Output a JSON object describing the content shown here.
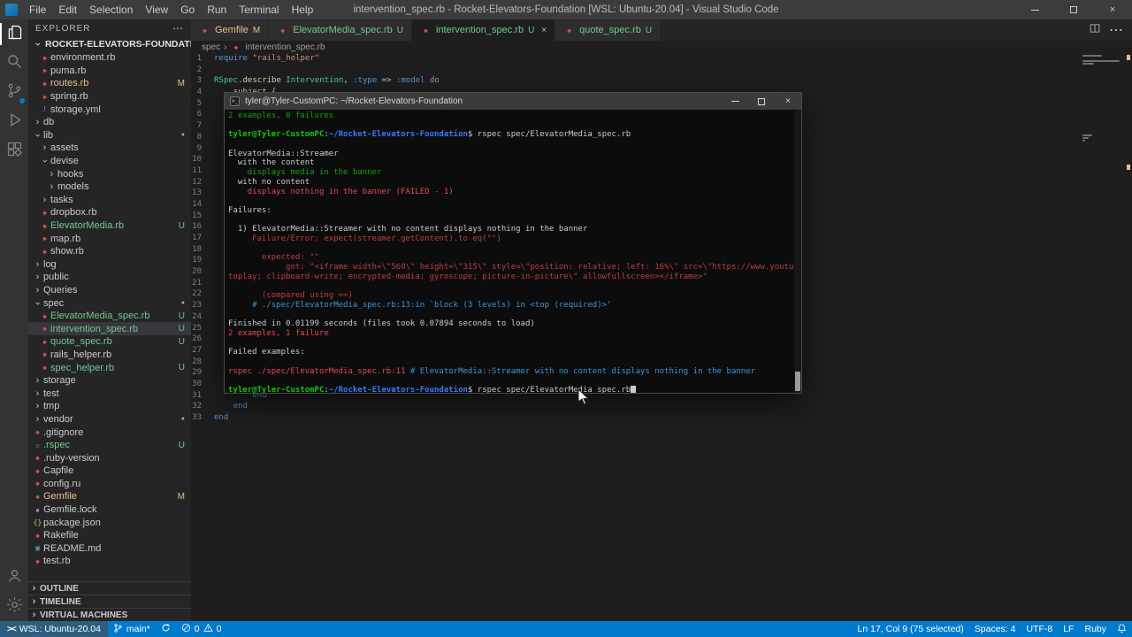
{
  "icons": {
    "chevron": "›",
    "more": "⋯",
    "close": "×",
    "remote": "><",
    "ruby_file": "◆",
    "breadcrumb_sep": "›"
  },
  "title_bar": {
    "menus": [
      "File",
      "Edit",
      "Selection",
      "View",
      "Go",
      "Run",
      "Terminal",
      "Help"
    ],
    "title": "intervention_spec.rb - Rocket-Elevators-Foundation [WSL: Ubuntu-20.04] - Visual Studio Code"
  },
  "activity_bar": {
    "top": [
      {
        "name": "explorer",
        "active": true
      },
      {
        "name": "search",
        "active": false
      },
      {
        "name": "source-control",
        "active": false,
        "badge": true
      },
      {
        "name": "run-debug",
        "active": false
      },
      {
        "name": "extensions",
        "active": false
      }
    ],
    "bottom": [
      {
        "name": "account",
        "active": false
      },
      {
        "name": "settings",
        "active": false
      }
    ]
  },
  "explorer": {
    "title": "EXPLORER",
    "workspace": "ROCKET-ELEVATORS-FOUNDATION [WSL: UBU...",
    "items": [
      {
        "label": "environment.rb",
        "kind": "file",
        "indent": 1,
        "icon": "ruby"
      },
      {
        "label": "puma.rb",
        "kind": "file",
        "indent": 1,
        "icon": "ruby"
      },
      {
        "label": "routes.rb",
        "kind": "file",
        "indent": 1,
        "icon": "ruby",
        "badge": "M",
        "git": "modified"
      },
      {
        "label": "spring.rb",
        "kind": "file",
        "indent": 1,
        "icon": "ruby"
      },
      {
        "label": "storage.yml",
        "kind": "file",
        "indent": 1,
        "icon": "yaml"
      },
      {
        "label": "db",
        "kind": "folder",
        "indent": 0,
        "chevron": "collapsed"
      },
      {
        "label": "lib",
        "kind": "folder",
        "indent": 0,
        "chevron": "expanded",
        "badge": "dot"
      },
      {
        "label": "assets",
        "kind": "folder",
        "indent": 1,
        "chevron": "collapsed"
      },
      {
        "label": "devise",
        "kind": "folder",
        "indent": 1,
        "chevron": "expanded"
      },
      {
        "label": "hooks",
        "kind": "folder",
        "indent": 2,
        "chevron": "collapsed"
      },
      {
        "label": "models",
        "kind": "folder",
        "indent": 2,
        "chevron": "collapsed"
      },
      {
        "label": "tasks",
        "kind": "folder",
        "indent": 1,
        "chevron": "collapsed"
      },
      {
        "label": "dropbox.rb",
        "kind": "file",
        "indent": 1,
        "icon": "ruby"
      },
      {
        "label": "ElevatorMedia.rb",
        "kind": "file",
        "indent": 1,
        "icon": "ruby",
        "badge": "U",
        "git": "untracked"
      },
      {
        "label": "map.rb",
        "kind": "file",
        "indent": 1,
        "icon": "ruby"
      },
      {
        "label": "show.rb",
        "kind": "file",
        "indent": 1,
        "icon": "ruby"
      },
      {
        "label": "log",
        "kind": "folder",
        "indent": 0,
        "chevron": "collapsed"
      },
      {
        "label": "public",
        "kind": "folder",
        "indent": 0,
        "chevron": "collapsed"
      },
      {
        "label": "Queries",
        "kind": "folder",
        "indent": 0,
        "chevron": "collapsed"
      },
      {
        "label": "spec",
        "kind": "folder",
        "indent": 0,
        "chevron": "expanded",
        "badge": "dot"
      },
      {
        "label": "ElevatorMedia_spec.rb",
        "kind": "file",
        "indent": 1,
        "icon": "ruby",
        "badge": "U",
        "git": "untracked"
      },
      {
        "label": "intervention_spec.rb",
        "kind": "file",
        "indent": 1,
        "icon": "ruby",
        "badge": "U",
        "git": "untracked",
        "selected": true
      },
      {
        "label": "quote_spec.rb",
        "kind": "file",
        "indent": 1,
        "icon": "ruby",
        "badge": "U",
        "git": "untracked"
      },
      {
        "label": "rails_helper.rb",
        "kind": "file",
        "indent": 1,
        "icon": "ruby"
      },
      {
        "label": "spec_helper.rb",
        "kind": "file",
        "indent": 1,
        "icon": "ruby",
        "badge": "U",
        "git": "untracked"
      },
      {
        "label": "storage",
        "kind": "folder",
        "indent": 0,
        "chevron": "collapsed"
      },
      {
        "label": "test",
        "kind": "folder",
        "indent": 0,
        "chevron": "collapsed"
      },
      {
        "label": "tmp",
        "kind": "folder",
        "indent": 0,
        "chevron": "collapsed"
      },
      {
        "label": "vendor",
        "kind": "folder",
        "indent": 0,
        "chevron": "collapsed",
        "badge": "dot"
      },
      {
        "label": ".gitignore",
        "kind": "file",
        "indent": 0,
        "icon": "git"
      },
      {
        "label": ".rspec",
        "kind": "file",
        "indent": 0,
        "icon": "generic",
        "badge": "U",
        "git": "untracked"
      },
      {
        "label": ".ruby-version",
        "kind": "file",
        "indent": 0,
        "icon": "ruby"
      },
      {
        "label": "Capfile",
        "kind": "file",
        "indent": 0,
        "icon": "ruby"
      },
      {
        "label": "config.ru",
        "kind": "file",
        "indent": 0,
        "icon": "ruby"
      },
      {
        "label": "Gemfile",
        "kind": "file",
        "indent": 0,
        "icon": "ruby",
        "badge": "M",
        "git": "modified"
      },
      {
        "label": "Gemfile.lock",
        "kind": "file",
        "indent": 0,
        "icon": "lock"
      },
      {
        "label": "package.json",
        "kind": "file",
        "indent": 0,
        "icon": "json"
      },
      {
        "label": "Rakefile",
        "kind": "file",
        "indent": 0,
        "icon": "ruby"
      },
      {
        "label": "README.md",
        "kind": "file",
        "indent": 0,
        "icon": "md"
      },
      {
        "label": "test.rb",
        "kind": "file",
        "indent": 0,
        "icon": "ruby"
      }
    ],
    "panels": [
      "OUTLINE",
      "TIMELINE",
      "VIRTUAL MACHINES"
    ]
  },
  "editor": {
    "tabs": [
      {
        "label": "Gemfile",
        "badge": "M",
        "git": "modified",
        "active": false
      },
      {
        "label": "ElevatorMedia_spec.rb",
        "badge": "U",
        "git": "untracked",
        "active": false
      },
      {
        "label": "intervention_spec.rb",
        "badge": "U",
        "git": "untracked",
        "active": true
      },
      {
        "label": "quote_spec.rb",
        "badge": "U",
        "git": "untracked",
        "active": false
      }
    ],
    "breadcrumb": [
      "spec",
      "intervention_spec.rb"
    ],
    "code_lines": [
      [
        {
          "t": "require ",
          "c": "k"
        },
        {
          "t": "\"rails_helper\"",
          "c": "s"
        }
      ],
      [],
      [
        {
          "t": "RSpec",
          "c": "t"
        },
        {
          "t": ".",
          "c": "p"
        },
        {
          "t": "describe",
          "c": "f"
        },
        {
          "t": " ",
          "c": "p"
        },
        {
          "t": "Intervention",
          "c": "t"
        },
        {
          "t": ", ",
          "c": "p"
        },
        {
          "t": ":type",
          "c": "k"
        },
        {
          "t": " => ",
          "c": "p"
        },
        {
          "t": ":model",
          "c": "k"
        },
        {
          "t": " ",
          "c": "p"
        },
        {
          "t": "do",
          "c": "kp"
        }
      ],
      [
        {
          "t": "    ",
          "c": "p"
        },
        {
          "t": "subject",
          "c": "f"
        },
        {
          "t": " {",
          "c": "p"
        }
      ],
      [],
      [],
      [],
      [],
      [],
      [],
      [],
      [],
      [],
      [],
      [],
      [],
      [],
      [],
      [],
      [],
      [],
      [],
      [],
      [],
      [],
      [],
      [],
      [],
      [],
      [],
      [
        {
          "t": "        ",
          "c": "p"
        },
        {
          "t": "end",
          "c": "k"
        }
      ],
      [
        {
          "t": "    ",
          "c": "p"
        },
        {
          "t": "end",
          "c": "k"
        }
      ],
      [
        {
          "t": "end",
          "c": "k"
        }
      ]
    ]
  },
  "terminal": {
    "title": "tyler@Tyler-CustomPC: ~/Rocket-Elevators-Foundation",
    "lines": [
      {
        "segs": [
          {
            "t": "2 examples, 0 failures",
            "c": "g"
          }
        ]
      },
      {
        "segs": []
      },
      {
        "segs": [
          {
            "t": "tyler@Tyler-CustomPC",
            "c": "gb"
          },
          {
            "t": ":",
            "c": "p"
          },
          {
            "t": "~/Rocket-Elevators-Foundation",
            "c": "bb"
          },
          {
            "t": "$ rspec spec/ElevatorMedia_spec.rb",
            "c": "p"
          }
        ]
      },
      {
        "segs": []
      },
      {
        "segs": [
          {
            "t": "ElevatorMedia::Streamer",
            "c": "p"
          }
        ]
      },
      {
        "segs": [
          {
            "t": "  with the content",
            "c": "p"
          }
        ]
      },
      {
        "segs": [
          {
            "t": "    displays media in the banner",
            "c": "g"
          }
        ]
      },
      {
        "segs": [
          {
            "t": "  with no content",
            "c": "p"
          }
        ]
      },
      {
        "segs": [
          {
            "t": "    displays nothing in the banner (FAILED - 1)",
            "c": "r"
          }
        ]
      },
      {
        "segs": []
      },
      {
        "segs": [
          {
            "t": "Failures:",
            "c": "p"
          }
        ]
      },
      {
        "segs": []
      },
      {
        "segs": [
          {
            "t": "  1) ElevatorMedia::Streamer with no content displays nothing in the banner",
            "c": "p"
          }
        ]
      },
      {
        "segs": [
          {
            "t": "     Failure/Error: expect(streamer.getContent).to eq(\"\")",
            "c": "rd"
          }
        ]
      },
      {
        "segs": []
      },
      {
        "segs": [
          {
            "t": "       expected: \"\"",
            "c": "rd"
          }
        ]
      },
      {
        "segs": [
          {
            "t": "            got: \"<iframe width=\\\"560\\\" height=\\\"315\\\" style=\\\"position: relative; left: 16%\\\" src=\\\"https://www.youtu",
            "c": "rd"
          }
        ]
      },
      {
        "segs": [
          {
            "t": "toplay; clipboard-write; encrypted-media; gyroscope; picture-in-picture\\\" allowfullscreen></iframe>\"",
            "c": "rd"
          }
        ]
      },
      {
        "segs": []
      },
      {
        "segs": [
          {
            "t": "       (compared using ==)",
            "c": "rd"
          }
        ]
      },
      {
        "segs": [
          {
            "t": "     # ./spec/ElevatorMedia_spec.rb:13:in `block (3 levels) in <top (required)>'",
            "c": "c"
          }
        ]
      },
      {
        "segs": []
      },
      {
        "segs": [
          {
            "t": "Finished in 0.01199 seconds (files took 0.07894 seconds to load)",
            "c": "p"
          }
        ]
      },
      {
        "segs": [
          {
            "t": "2 examples, 1 failure",
            "c": "r"
          }
        ]
      },
      {
        "segs": []
      },
      {
        "segs": [
          {
            "t": "Failed examples:",
            "c": "p"
          }
        ]
      },
      {
        "segs": []
      },
      {
        "segs": [
          {
            "t": "rspec ./spec/ElevatorMedia_spec.rb:11",
            "c": "r"
          },
          {
            "t": " # ElevatorMedia::Streamer with no content displays nothing in the banner",
            "c": "c"
          }
        ]
      },
      {
        "segs": []
      },
      {
        "segs": [
          {
            "t": "tyler@Tyler-CustomPC",
            "c": "gb"
          },
          {
            "t": ":",
            "c": "p"
          },
          {
            "t": "~/Rocket-Elevators-Foundation",
            "c": "bb"
          },
          {
            "t": "$ rspec spec/ElevatorMedia_spec.rb",
            "c": "p"
          },
          {
            "t": " ",
            "c": "cur"
          }
        ]
      }
    ]
  },
  "status_bar": {
    "remote_label": "WSL: Ubuntu-20.04",
    "branch": "main*",
    "errors": "0",
    "warnings": "0",
    "right": [
      {
        "name": "cursor-position",
        "label": "Ln 17, Col 9 (75 selected)"
      },
      {
        "name": "indentation",
        "label": "Spaces: 4"
      },
      {
        "name": "encoding",
        "label": "UTF-8"
      },
      {
        "name": "eol",
        "label": "LF"
      },
      {
        "name": "language-mode",
        "label": "Ruby"
      }
    ]
  }
}
